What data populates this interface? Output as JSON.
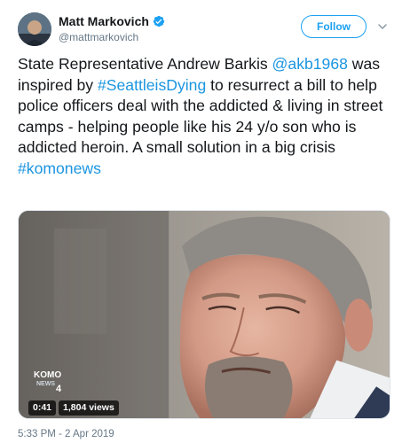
{
  "author": {
    "display_name": "Matt Markovich",
    "handle": "@mattmarkovich",
    "verified": true
  },
  "follow_button": {
    "label": "Follow"
  },
  "tweet": {
    "segments": [
      {
        "text": "State Representative Andrew Barkis ",
        "type": "text"
      },
      {
        "text": "@akb1968",
        "type": "mention"
      },
      {
        "text": " was inspired by ",
        "type": "text"
      },
      {
        "text": "#SeattleisDying",
        "type": "hashtag"
      },
      {
        "text": " to resurrect a bill to help police officers deal with the addicted & living in street camps - helping people like his 24 y/o son who is addicted heroin. A small solution in a big crisis ",
        "type": "text"
      },
      {
        "text": "#komonews",
        "type": "hashtag"
      }
    ]
  },
  "video": {
    "duration": "0:41",
    "views": "1,804 views",
    "logo_text_top": "KOMO",
    "logo_text_mid": "NEWS",
    "logo_text_num": "4"
  },
  "timestamp": "5:33 PM - 2 Apr 2019",
  "colors": {
    "accent": "#1da1f2",
    "link": "#1b95e0",
    "secondary_text": "#657786"
  },
  "icons": {
    "verified": "verified-badge-icon",
    "chevron": "chevron-down-icon"
  }
}
